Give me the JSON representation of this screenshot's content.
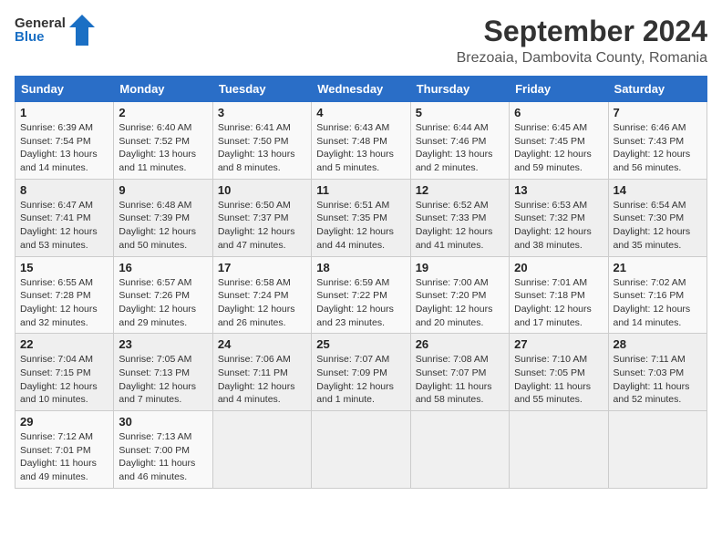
{
  "header": {
    "logo_line1": "General",
    "logo_line2": "Blue",
    "month": "September 2024",
    "location": "Brezoaia, Dambovita County, Romania"
  },
  "weekdays": [
    "Sunday",
    "Monday",
    "Tuesday",
    "Wednesday",
    "Thursday",
    "Friday",
    "Saturday"
  ],
  "weeks": [
    [
      {
        "day": "1",
        "info": "Sunrise: 6:39 AM\nSunset: 7:54 PM\nDaylight: 13 hours and 14 minutes."
      },
      {
        "day": "2",
        "info": "Sunrise: 6:40 AM\nSunset: 7:52 PM\nDaylight: 13 hours and 11 minutes."
      },
      {
        "day": "3",
        "info": "Sunrise: 6:41 AM\nSunset: 7:50 PM\nDaylight: 13 hours and 8 minutes."
      },
      {
        "day": "4",
        "info": "Sunrise: 6:43 AM\nSunset: 7:48 PM\nDaylight: 13 hours and 5 minutes."
      },
      {
        "day": "5",
        "info": "Sunrise: 6:44 AM\nSunset: 7:46 PM\nDaylight: 13 hours and 2 minutes."
      },
      {
        "day": "6",
        "info": "Sunrise: 6:45 AM\nSunset: 7:45 PM\nDaylight: 12 hours and 59 minutes."
      },
      {
        "day": "7",
        "info": "Sunrise: 6:46 AM\nSunset: 7:43 PM\nDaylight: 12 hours and 56 minutes."
      }
    ],
    [
      {
        "day": "8",
        "info": "Sunrise: 6:47 AM\nSunset: 7:41 PM\nDaylight: 12 hours and 53 minutes."
      },
      {
        "day": "9",
        "info": "Sunrise: 6:48 AM\nSunset: 7:39 PM\nDaylight: 12 hours and 50 minutes."
      },
      {
        "day": "10",
        "info": "Sunrise: 6:50 AM\nSunset: 7:37 PM\nDaylight: 12 hours and 47 minutes."
      },
      {
        "day": "11",
        "info": "Sunrise: 6:51 AM\nSunset: 7:35 PM\nDaylight: 12 hours and 44 minutes."
      },
      {
        "day": "12",
        "info": "Sunrise: 6:52 AM\nSunset: 7:33 PM\nDaylight: 12 hours and 41 minutes."
      },
      {
        "day": "13",
        "info": "Sunrise: 6:53 AM\nSunset: 7:32 PM\nDaylight: 12 hours and 38 minutes."
      },
      {
        "day": "14",
        "info": "Sunrise: 6:54 AM\nSunset: 7:30 PM\nDaylight: 12 hours and 35 minutes."
      }
    ],
    [
      {
        "day": "15",
        "info": "Sunrise: 6:55 AM\nSunset: 7:28 PM\nDaylight: 12 hours and 32 minutes."
      },
      {
        "day": "16",
        "info": "Sunrise: 6:57 AM\nSunset: 7:26 PM\nDaylight: 12 hours and 29 minutes."
      },
      {
        "day": "17",
        "info": "Sunrise: 6:58 AM\nSunset: 7:24 PM\nDaylight: 12 hours and 26 minutes."
      },
      {
        "day": "18",
        "info": "Sunrise: 6:59 AM\nSunset: 7:22 PM\nDaylight: 12 hours and 23 minutes."
      },
      {
        "day": "19",
        "info": "Sunrise: 7:00 AM\nSunset: 7:20 PM\nDaylight: 12 hours and 20 minutes."
      },
      {
        "day": "20",
        "info": "Sunrise: 7:01 AM\nSunset: 7:18 PM\nDaylight: 12 hours and 17 minutes."
      },
      {
        "day": "21",
        "info": "Sunrise: 7:02 AM\nSunset: 7:16 PM\nDaylight: 12 hours and 14 minutes."
      }
    ],
    [
      {
        "day": "22",
        "info": "Sunrise: 7:04 AM\nSunset: 7:15 PM\nDaylight: 12 hours and 10 minutes."
      },
      {
        "day": "23",
        "info": "Sunrise: 7:05 AM\nSunset: 7:13 PM\nDaylight: 12 hours and 7 minutes."
      },
      {
        "day": "24",
        "info": "Sunrise: 7:06 AM\nSunset: 7:11 PM\nDaylight: 12 hours and 4 minutes."
      },
      {
        "day": "25",
        "info": "Sunrise: 7:07 AM\nSunset: 7:09 PM\nDaylight: 12 hours and 1 minute."
      },
      {
        "day": "26",
        "info": "Sunrise: 7:08 AM\nSunset: 7:07 PM\nDaylight: 11 hours and 58 minutes."
      },
      {
        "day": "27",
        "info": "Sunrise: 7:10 AM\nSunset: 7:05 PM\nDaylight: 11 hours and 55 minutes."
      },
      {
        "day": "28",
        "info": "Sunrise: 7:11 AM\nSunset: 7:03 PM\nDaylight: 11 hours and 52 minutes."
      }
    ],
    [
      {
        "day": "29",
        "info": "Sunrise: 7:12 AM\nSunset: 7:01 PM\nDaylight: 11 hours and 49 minutes."
      },
      {
        "day": "30",
        "info": "Sunrise: 7:13 AM\nSunset: 7:00 PM\nDaylight: 11 hours and 46 minutes."
      },
      {
        "day": "",
        "info": ""
      },
      {
        "day": "",
        "info": ""
      },
      {
        "day": "",
        "info": ""
      },
      {
        "day": "",
        "info": ""
      },
      {
        "day": "",
        "info": ""
      }
    ]
  ]
}
